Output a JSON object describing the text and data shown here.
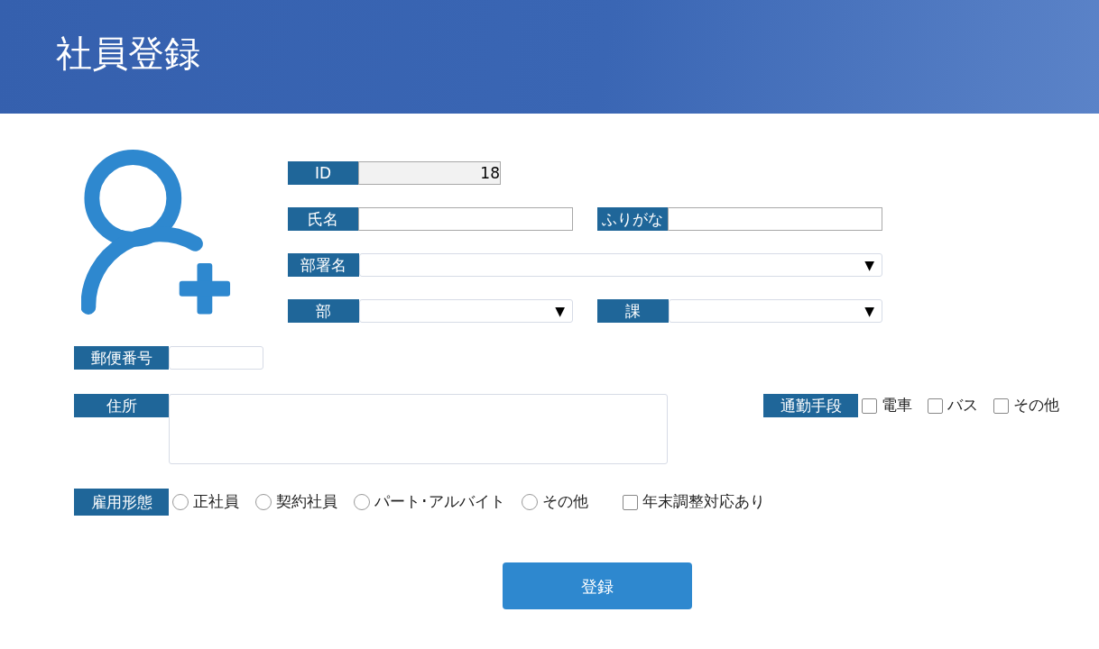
{
  "header": {
    "title": "社員登録"
  },
  "id_field": {
    "label": "ID",
    "value": "18"
  },
  "name_row": [
    {
      "label": "氏名"
    },
    {
      "label": "ふりがな"
    }
  ],
  "department_name": {
    "label": "部署名",
    "caret": "▼"
  },
  "division_row": [
    {
      "label": "部",
      "caret": "▼"
    },
    {
      "label": "課",
      "caret": "▼"
    }
  ],
  "postal_code": {
    "label": "郵便番号"
  },
  "address": {
    "label": "住所"
  },
  "commute": {
    "label": "通勤手段",
    "options": [
      {
        "label": "電車",
        "checked": false
      },
      {
        "label": "バス",
        "checked": false
      },
      {
        "label": "その他",
        "checked": false
      }
    ]
  },
  "employment": {
    "label": "雇用形態",
    "options": [
      {
        "label": "正社員",
        "selected": false
      },
      {
        "label": "契約社員",
        "selected": false
      },
      {
        "label": "パート･アルバイト",
        "selected": false
      },
      {
        "label": "その他",
        "selected": false
      }
    ]
  },
  "year_end_adjustment": {
    "label": "年末調整対応あり",
    "checked": false
  },
  "submit": {
    "label": "登録"
  }
}
